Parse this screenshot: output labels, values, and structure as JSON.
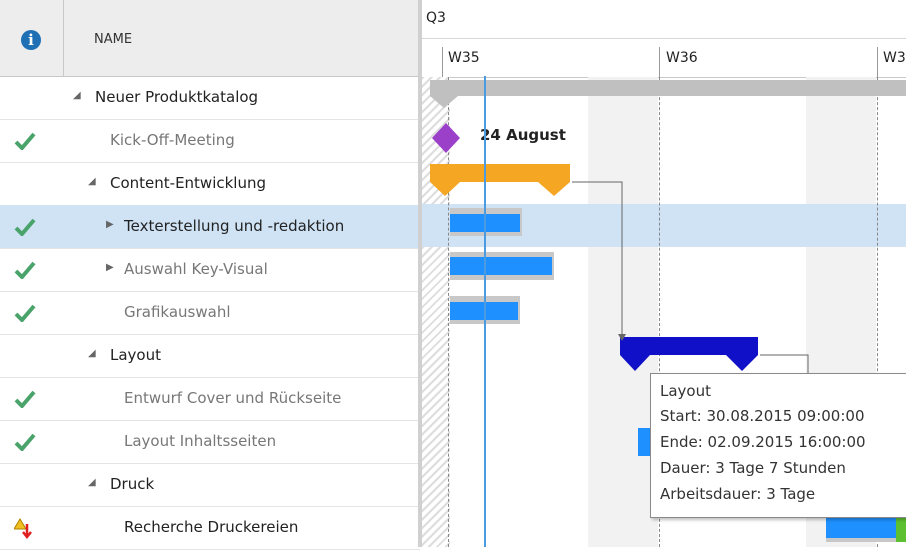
{
  "header": {
    "name_column": "NAME",
    "info_icon": "i"
  },
  "timeline": {
    "quarter": "Q3",
    "weeks": [
      "W35",
      "W36",
      "W3"
    ]
  },
  "rows": [
    {
      "label": "Neuer Produktkatalog",
      "status": "",
      "expander": "collapse"
    },
    {
      "label": "Kick-Off-Meeting",
      "status": "done",
      "expander": ""
    },
    {
      "label": "Content-Entwicklung",
      "status": "",
      "expander": "collapse"
    },
    {
      "label": "Texterstellung und -redaktion",
      "status": "done",
      "expander": "expand",
      "selected": true
    },
    {
      "label": "Auswahl Key-Visual",
      "status": "done",
      "expander": "expand"
    },
    {
      "label": "Grafikauswahl",
      "status": "done",
      "expander": ""
    },
    {
      "label": "Layout",
      "status": "",
      "expander": "collapse"
    },
    {
      "label": "Entwurf Cover und Rückseite",
      "status": "done",
      "expander": ""
    },
    {
      "label": "Layout Inhaltsseiten",
      "status": "done",
      "expander": ""
    },
    {
      "label": "Druck",
      "status": "",
      "expander": "collapse"
    },
    {
      "label": "Recherche Druckereien",
      "status": "warning",
      "expander": ""
    }
  ],
  "milestone": {
    "label": "24 August"
  },
  "tooltip": {
    "title": "Layout",
    "start": "Start: 30.08.2015 09:00:00",
    "end": "Ende: 02.09.2015 16:00:00",
    "duration": "Dauer: 3 Tage 7 Stunden",
    "work": "Arbeitsdauer: 3 Tage"
  },
  "colors": {
    "summary_gray": "#c0c0c0",
    "summary_orange": "#f5a623",
    "summary_blue": "#1010c8",
    "task_blue": "#1e90ff",
    "milestone": "#9b40c8",
    "today_line": "#4a9be0",
    "check_green": "#4aa36b"
  }
}
